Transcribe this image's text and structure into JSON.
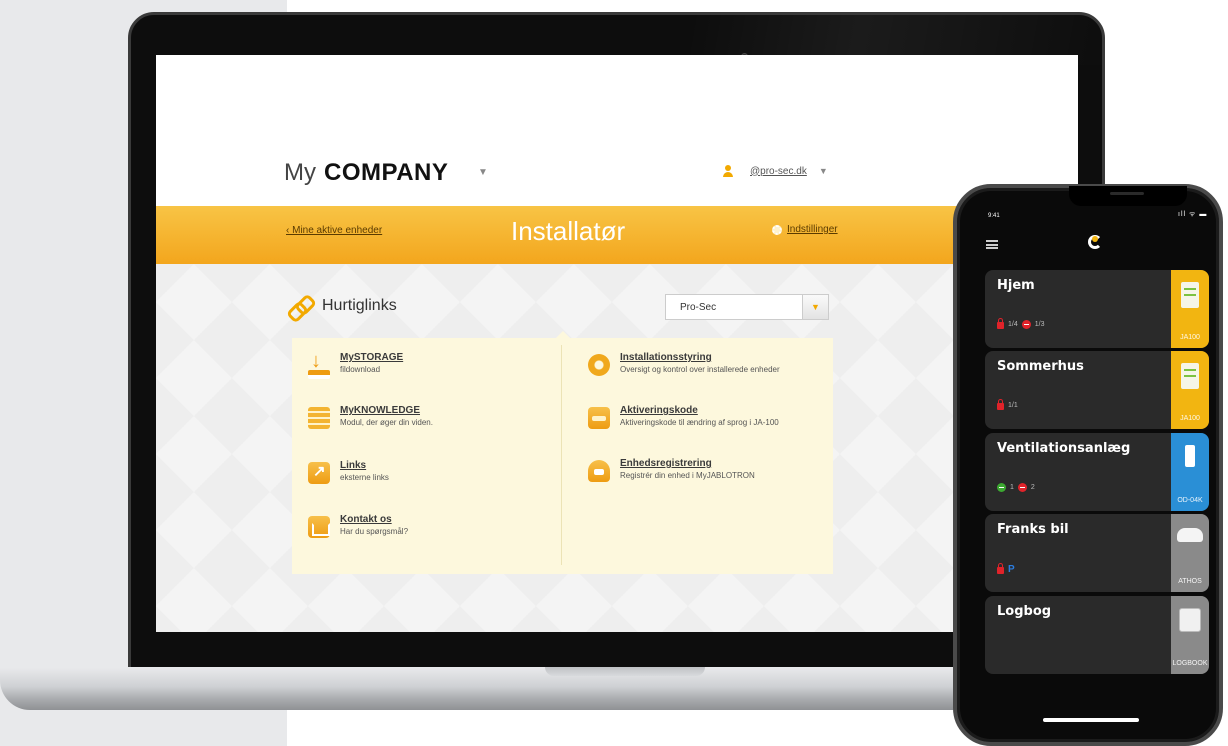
{
  "colors": {
    "accent_orange": "#f3a61d",
    "panel_cream": "#fdf8dd",
    "phone_card": "#2a2a2a",
    "ja100_yellow": "#f2b511",
    "od04k_blue": "#2a8fd6",
    "athos_gray": "#8a8a8a",
    "lock_red": "#e0232a",
    "ok_green": "#3ca831"
  },
  "site": {
    "brand_my": "My",
    "brand_company": "COMPANY",
    "brand_caret": "▼",
    "user_email": "@pro-sec.dk",
    "user_caret": "▼",
    "nav_back": "‹ Mine aktive enheder",
    "nav_title": "Installatør",
    "nav_settings": "Indstillinger",
    "quicklinks_title": "Hurtiglinks",
    "dropdown_value": "Pro-Sec",
    "dropdown_caret": "▼",
    "left_items": [
      {
        "title": "MySTORAGE",
        "sub": "fildownload",
        "icon": "download-icon"
      },
      {
        "title": "MyKNOWLEDGE",
        "sub": "Modul, der øger din viden.",
        "icon": "books-icon"
      },
      {
        "title": "Links",
        "sub": "eksterne links",
        "icon": "share-icon"
      },
      {
        "title": "Kontakt os",
        "sub": "Har du spørgsmål?",
        "icon": "mail-icon"
      }
    ],
    "right_items": [
      {
        "title": "Installationsstyring",
        "sub": "Oversigt og kontrol over installerede enheder",
        "icon": "gear-icon"
      },
      {
        "title": "Aktiveringskode",
        "sub": "Aktiveringskode til ændring af sprog i JA-100",
        "icon": "wallet-icon"
      },
      {
        "title": "Enhedsregistrering",
        "sub": "Registrér din enhed i MyJABLOTRON",
        "icon": "cloud-icon"
      }
    ]
  },
  "phone": {
    "time": "9:41",
    "status_icons": "ıll ᯤ ▬",
    "cards": [
      {
        "name": "Hjem",
        "status1": "1/4",
        "status2": "1/3",
        "device": "JA100"
      },
      {
        "name": "Sommerhus",
        "status1": "1/1",
        "device": "JA100"
      },
      {
        "name": "Ventilationsanlæg",
        "status1": "1",
        "status2": "2",
        "device": "OD-04K"
      },
      {
        "name": "Franks bil",
        "status_p": "P",
        "device": "ATHOS"
      },
      {
        "name": "Logbog",
        "device": "LOGBOOK"
      }
    ]
  }
}
